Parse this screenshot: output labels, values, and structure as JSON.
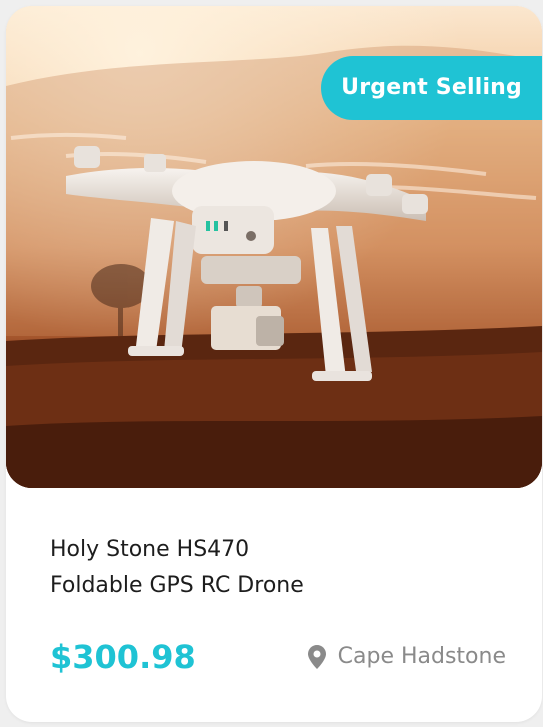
{
  "card": {
    "badge": "Urgent Selling",
    "title_line1": "Holy Stone HS470",
    "title_line2": "Foldable GPS RC Drone",
    "price": "$300.98",
    "location": "Cape Hadstone",
    "icons": {
      "location": "map-pin-icon"
    },
    "colors": {
      "accent": "#1fc3d4",
      "text": "#1d1d1d",
      "muted": "#8a8a8a"
    }
  }
}
